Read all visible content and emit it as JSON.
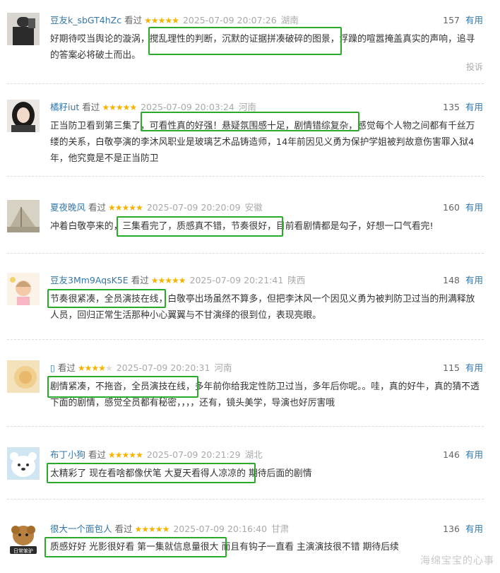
{
  "comments": [
    {
      "user": "豆友k_sbGT4hZc",
      "watched": "看过",
      "rating": 5,
      "time": "2025-07-09 20:07:26",
      "location": "湖南",
      "votes": "157",
      "useful": "有用",
      "text": "好期待哎当舆论的漩涡，搅乱理性的判断，沉默的证据拼凑破碎的图景，浮躁的喧嚣掩盖真实的声响，追寻的答案必将破土而出。",
      "report": "投诉"
    },
    {
      "user": "橘籽iut",
      "watched": "看过",
      "rating": 5,
      "time": "2025-07-09 20:03:24",
      "location": "河南",
      "votes": "135",
      "useful": "有用",
      "text": "正当防卫看到第三集了，可看性真的好强！悬疑氛围感十足，剧情错综复杂，感觉每个人物之间都有千丝万缕的关系，白敬亭演的李沐风职业是玻璃艺术品铸造师，14年前因见义勇为保护学姐被判故意伤害罪入狱4年，他究竟是不是正当防卫"
    },
    {
      "user": "夏夜晚风",
      "watched": "看过",
      "rating": 5,
      "time": "2025-07-09 20:20:09",
      "location": "安徽",
      "votes": "160",
      "useful": "有用",
      "text": "冲着白敬亭来的，三集看完了，质感真不错，节奏很好，目前看剧情都是勾子，好想一口气看完!"
    },
    {
      "user": "豆友3Mm9AqsK5E",
      "watched": "看过",
      "rating": 5,
      "time": "2025-07-09 20:21:41",
      "location": "陕西",
      "votes": "148",
      "useful": "有用",
      "text": "节奏很紧凑，全员演技在线，白敬亭出场虽然不算多，但把李沐风一个因见义勇为被判防卫过当的刑满释放人员，回归正常生活那种小心翼翼与不甘演绎的很到位，表现亮眼。"
    },
    {
      "user": "▯",
      "watched": "看过",
      "rating": 4,
      "time": "2025-07-09 20:20:31",
      "location": "河南",
      "votes": "115",
      "useful": "有用",
      "text": "剧情紧凑，不拖沓，全员演技在线，多年前你给我定性防卫过当，多年后你呢。。哇，真的好牛，真的猜不透下面的剧情，感觉全员都有秘密，，，，还有，镜头美学，导演也好厉害哦"
    },
    {
      "user": "布丁小狗",
      "watched": "看过",
      "rating": 5,
      "time": "2025-07-09 20:21:29",
      "location": "湖北",
      "votes": "146",
      "useful": "有用",
      "text": "太精彩了 现在看啥都像伏笔 大夏天看得人凉凉的 期待后面的剧情"
    },
    {
      "user": "很大一个面包人",
      "watched": "看过",
      "rating": 5,
      "time": "2025-07-09 20:16:40",
      "location": "甘肃",
      "votes": "136",
      "useful": "有用",
      "text": "质感好好 光影很好看 第一集就信息量很大 而且有钩子一直看 主演演技很不错 期待后续"
    }
  ],
  "avatar_labels": [
    "",
    "",
    "",
    "",
    "",
    "",
    "日常笨驴"
  ],
  "watermark": "海绵宝宝的心事",
  "colors": {
    "highlight": "#2aa92a",
    "link": "#3377aa",
    "star": "#f4b400"
  }
}
